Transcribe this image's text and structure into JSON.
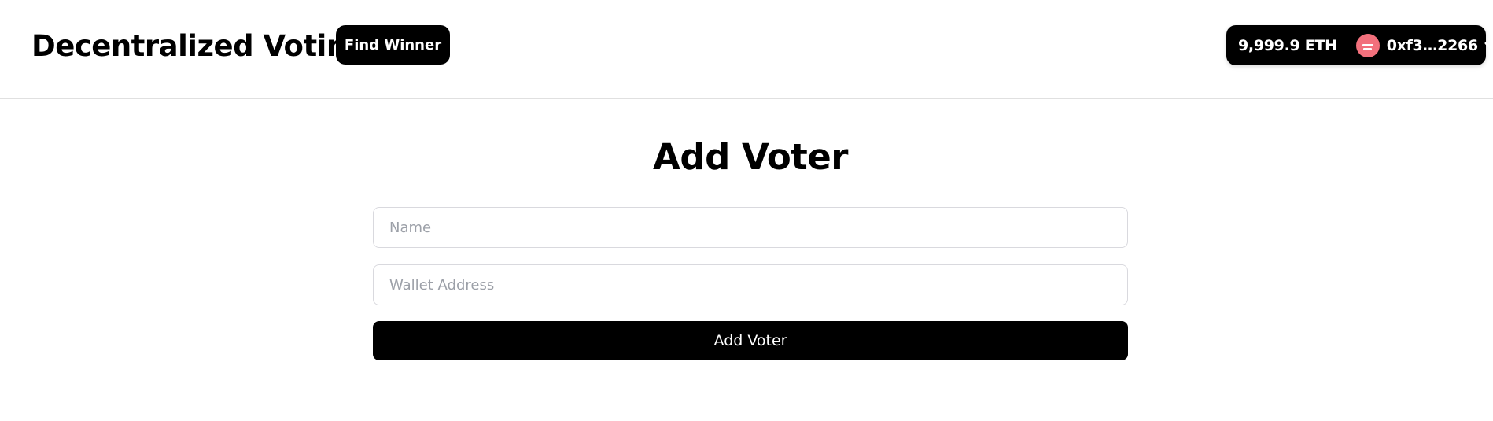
{
  "header": {
    "title": "Decentralized Voting",
    "find_winner_label": "Find Winner",
    "wallet": {
      "balance": "9,999.9 ETH",
      "address": "0xf3…2266",
      "avatar_color": "#f2707c",
      "dropdown_icon": "chevron-down-icon"
    }
  },
  "form": {
    "title": "Add Voter",
    "name_placeholder": "Name",
    "name_value": "",
    "wallet_placeholder": "Wallet Address",
    "wallet_value": "",
    "submit_label": "Add Voter"
  },
  "colors": {
    "primary": "#000000",
    "background": "#ffffff",
    "border": "#d9d9de",
    "placeholder": "#9ca0a8"
  }
}
